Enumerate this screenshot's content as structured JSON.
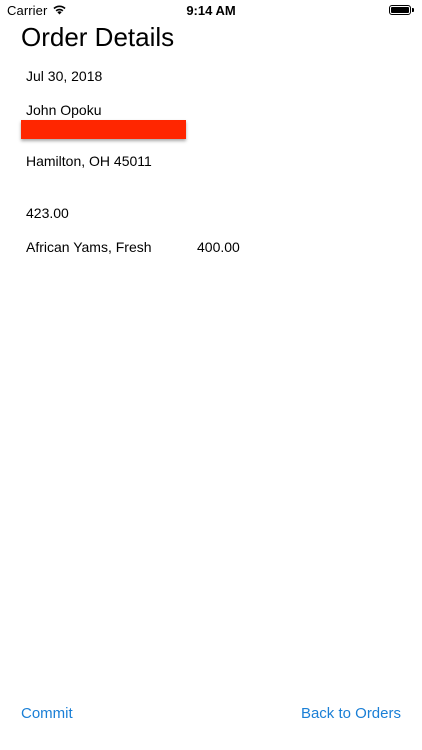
{
  "status_bar": {
    "carrier": "Carrier",
    "time": "9:14 AM",
    "wifi_icon": "wifi-icon",
    "battery_icon": "battery-icon"
  },
  "header": {
    "title": "Order Details"
  },
  "order": {
    "date": "Jul 30, 2018",
    "customer_name": "John Opoku",
    "city_state_zip": "Hamilton, OH 45011",
    "total": "423.00",
    "items": [
      {
        "name": "African Yams, Fresh",
        "price": "400.00"
      }
    ]
  },
  "toolbar": {
    "commit_label": "Commit",
    "back_label": "Back to Orders"
  },
  "colors": {
    "accent": "#1a7fd6",
    "redaction": "#ff2600"
  }
}
